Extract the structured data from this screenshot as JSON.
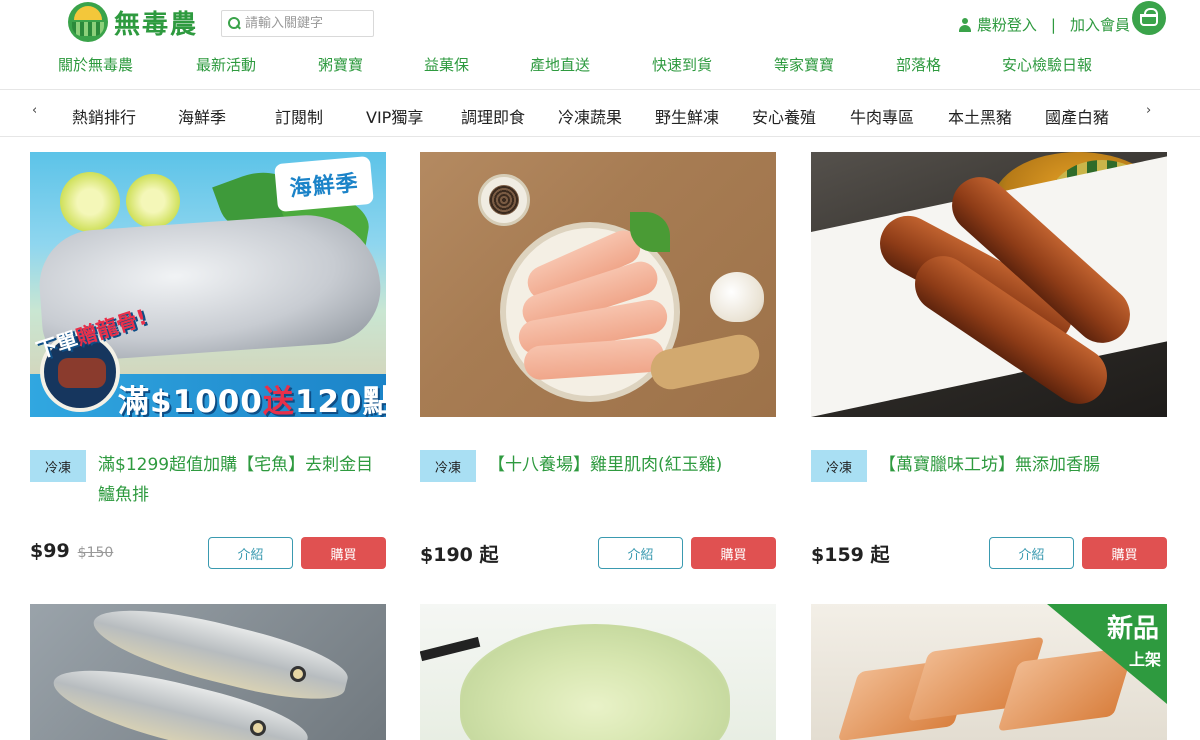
{
  "brand": {
    "name": "無毒農"
  },
  "search": {
    "placeholder": "請輸入關鍵字"
  },
  "account": {
    "login": "農粉登入",
    "separator": "|",
    "register": "加入會員"
  },
  "top_nav": [
    "關於無毒農",
    "最新活動",
    "粥寶寶",
    "益菓保",
    "產地直送",
    "快速到貨",
    "等家寶寶",
    "部落格",
    "安心檢驗日報"
  ],
  "categories": {
    "prev": "‹",
    "next": "›",
    "items": [
      "熱銷排行",
      "海鮮季",
      "訂閱制",
      "VIP獨享",
      "調理即食",
      "冷凍蔬果",
      "野生鮮凍",
      "安心養殖",
      "牛肉專區",
      "本土黑豬",
      "國產白豬"
    ]
  },
  "products": [
    {
      "badge": "冷凍",
      "title": "滿$1299超值加購【宅魚】去刺金目鱸魚排",
      "price": "$99",
      "old_price": "$150",
      "intro_label": "介紹",
      "buy_label": "購買",
      "image": {
        "season_tag": "海鮮季",
        "promo_tag_a": "下單",
        "promo_tag_b": "贈龍骨!",
        "promo_main_a": "滿$1000",
        "promo_main_b": "送",
        "promo_main_c": "120點"
      }
    },
    {
      "badge": "冷凍",
      "title": "【十八養場】雞里肌肉(紅玉雞)",
      "price": "$190 起",
      "intro_label": "介紹",
      "buy_label": "購買"
    },
    {
      "badge": "冷凍",
      "title": "【萬寶臘味工坊】無添加香腸",
      "price": "$159 起",
      "intro_label": "介紹",
      "buy_label": "購買"
    }
  ],
  "next_row": {
    "new_badge": "新品",
    "new_badge_sub": "上架"
  },
  "colors": {
    "brand_green": "#2e9a3f",
    "badge_blue": "#a9dff3",
    "buy_red": "#e05151",
    "intro_border": "#3a9ab0"
  }
}
